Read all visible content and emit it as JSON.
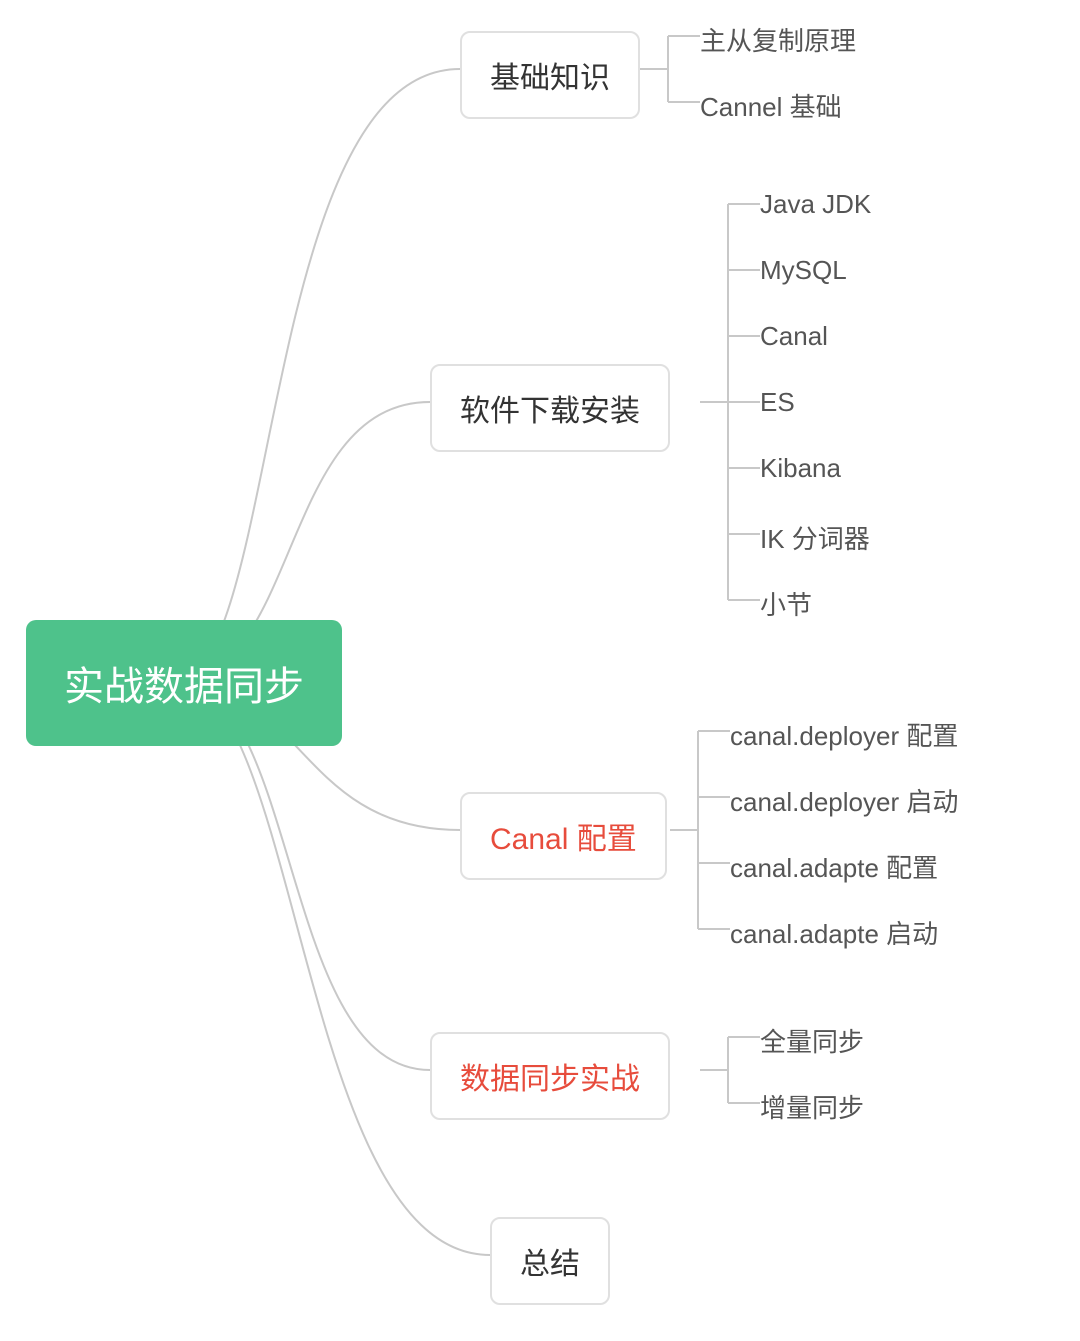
{
  "root": {
    "label": "实战数据同步",
    "color": "#4ec28b"
  },
  "branches": [
    {
      "id": "basics",
      "label": "基础知识",
      "highlight": false,
      "children": [
        {
          "label": "主从复制原理"
        },
        {
          "label": "Cannel 基础"
        }
      ]
    },
    {
      "id": "install",
      "label": "软件下载安装",
      "highlight": false,
      "children": [
        {
          "label": "Java JDK"
        },
        {
          "label": "MySQL"
        },
        {
          "label": "Canal"
        },
        {
          "label": "ES"
        },
        {
          "label": "Kibana"
        },
        {
          "label": "IK 分词器"
        },
        {
          "label": "小节"
        }
      ]
    },
    {
      "id": "canal-config",
      "label": "Canal 配置",
      "highlight": true,
      "children": [
        {
          "label": "canal.deployer 配置"
        },
        {
          "label": "canal.deployer 启动"
        },
        {
          "label": "canal.adapte 配置"
        },
        {
          "label": "canal.adapte 启动"
        }
      ]
    },
    {
      "id": "sync",
      "label": "数据同步实战",
      "highlight": true,
      "children": [
        {
          "label": "全量同步"
        },
        {
          "label": "增量同步"
        }
      ]
    },
    {
      "id": "summary",
      "label": "总结",
      "highlight": false,
      "children": []
    }
  ]
}
